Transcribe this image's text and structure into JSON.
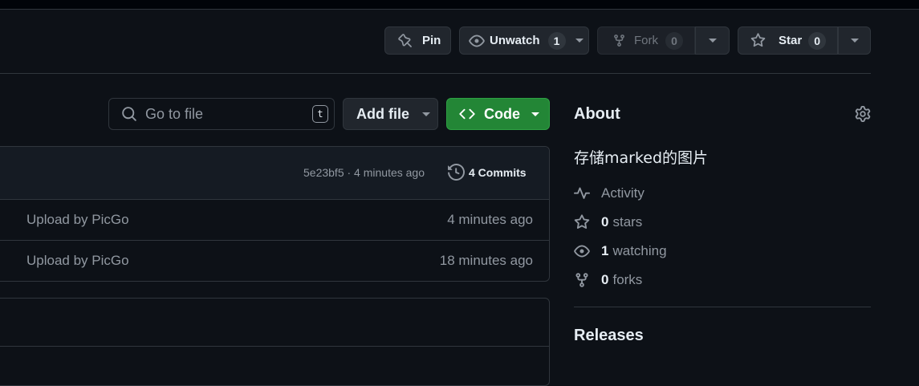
{
  "header": {
    "pin_label": "Pin",
    "unwatch_label": "Unwatch",
    "watch_count": "1",
    "fork_label": "Fork",
    "fork_count": "0",
    "star_label": "Star",
    "star_count": "0"
  },
  "toolbar": {
    "search_placeholder": "Go to file",
    "search_shortcut": "t",
    "add_file_label": "Add file",
    "code_label": "Code"
  },
  "commit_bar": {
    "commit_info": "5e23bf5 · 4 minutes ago",
    "commits_label": "4 Commits"
  },
  "files": [
    {
      "message": "Upload by PicGo",
      "time": "4 minutes ago"
    },
    {
      "message": "Upload by PicGo",
      "time": "18 minutes ago"
    }
  ],
  "about": {
    "title": "About",
    "description": "存储marked的图片",
    "activity_label": "Activity",
    "stars_count": "0",
    "stars_label": "stars",
    "watching_count": "1",
    "watching_label": "watching",
    "forks_count": "0",
    "forks_label": "forks"
  },
  "releases": {
    "title": "Releases"
  },
  "colors": {
    "background": "#0d1117",
    "button": "#21262d",
    "border": "#30363d",
    "code_button": "#238636",
    "muted_text": "#9198a1"
  },
  "icons": [
    "pin-icon",
    "eye-icon",
    "fork-icon",
    "star-icon",
    "search-icon",
    "code-icon",
    "history-icon",
    "pulse-icon",
    "gear-icon"
  ]
}
